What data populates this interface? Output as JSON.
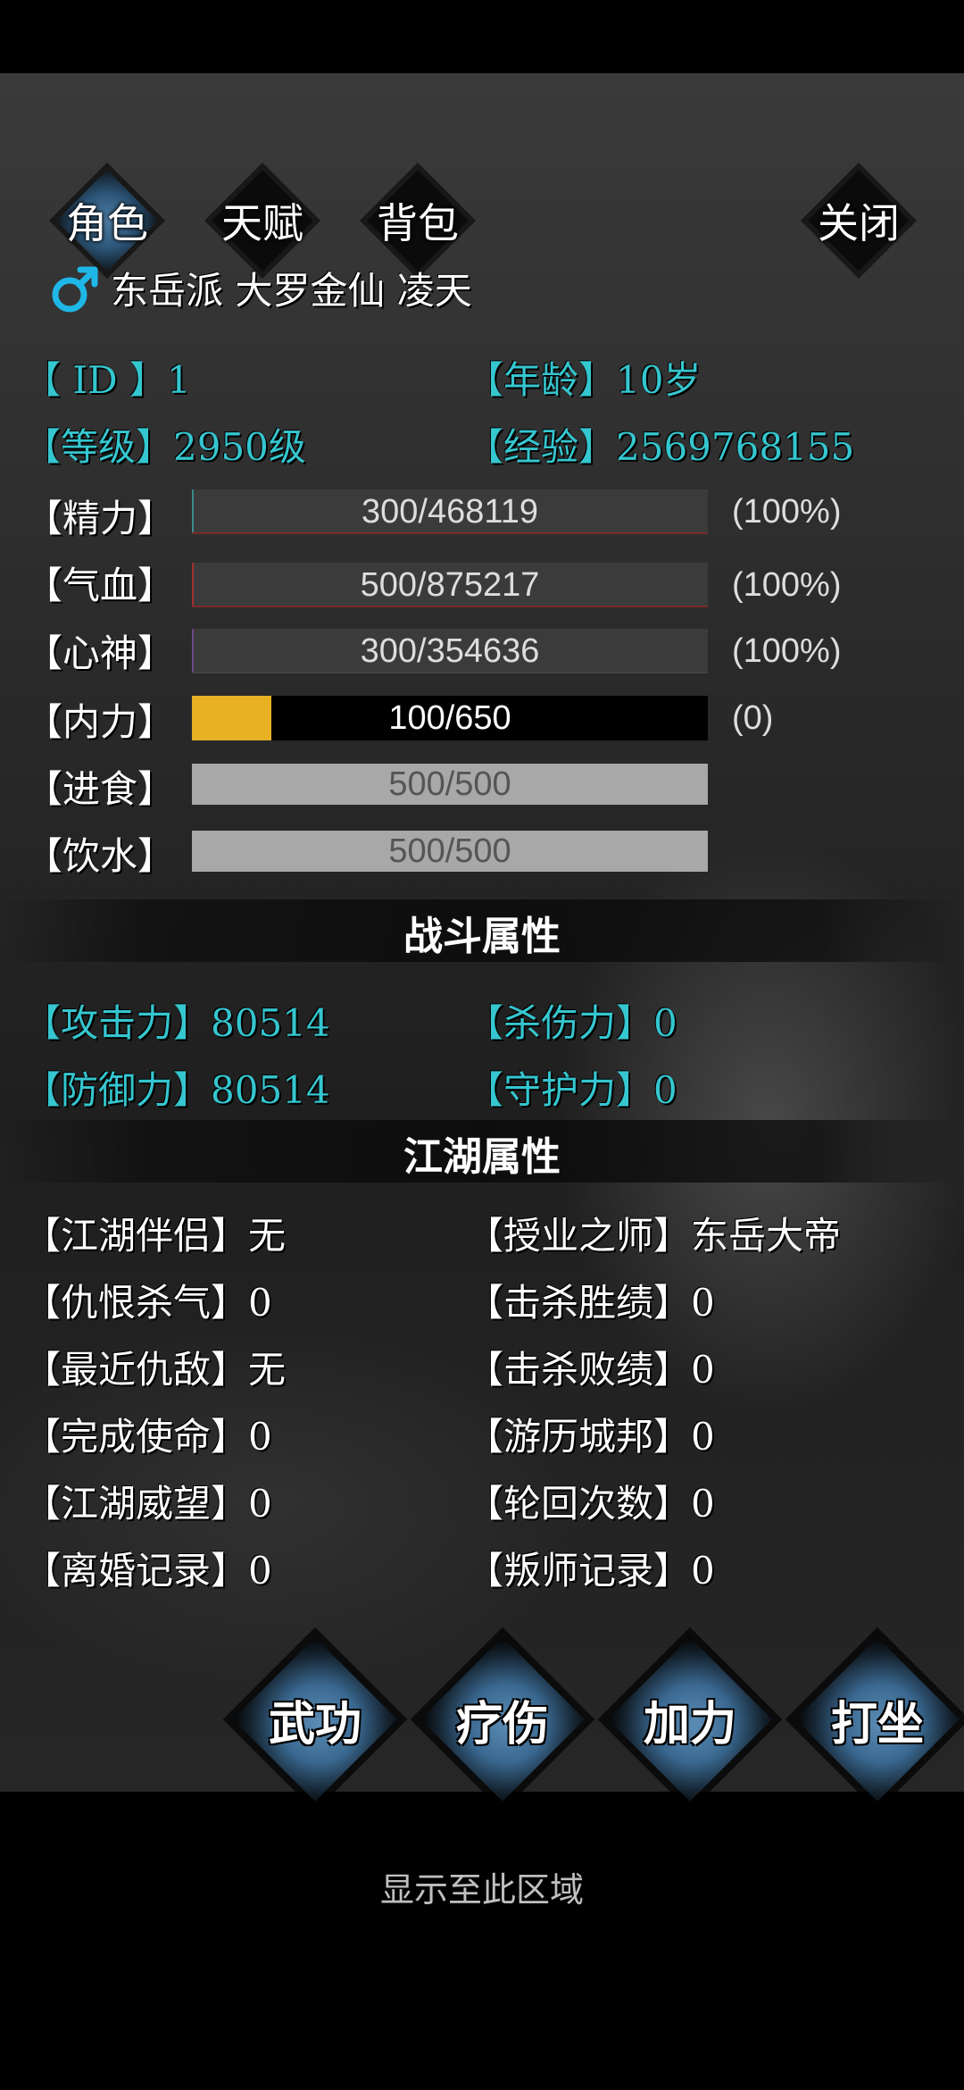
{
  "tabs": [
    {
      "label": "角色",
      "active": true
    },
    {
      "label": "天赋",
      "active": false
    },
    {
      "label": "背包",
      "active": false
    }
  ],
  "close_label": "关闭",
  "profile": {
    "gender_icon": "male-icon",
    "title_line": "东岳派 大罗金仙 凌天"
  },
  "info": {
    "id_label": "【 ID 】",
    "id_value": "1",
    "age_label": "【年龄】",
    "age_value": "10岁",
    "level_label": "【等级】",
    "level_value": "2950级",
    "exp_label": "【经验】",
    "exp_value": "2569768155"
  },
  "bars": [
    {
      "label": "【精力】",
      "text": "300/468119",
      "pct": "(100%)",
      "fill": 0.0,
      "fill_color": "#3a8a8a",
      "bg": "#3b3b3b",
      "border": "#7a2a2a"
    },
    {
      "label": "【气血】",
      "text": "500/875217",
      "pct": "(100%)",
      "fill": 0.0,
      "fill_color": "#a03030",
      "bg": "#3b3b3b",
      "border": "#7a2a2a"
    },
    {
      "label": "【心神】",
      "text": "300/354636",
      "pct": "(100%)",
      "fill": 0.0,
      "fill_color": "#6a4a8a",
      "bg": "#3b3b3b",
      "border": "#444"
    },
    {
      "label": "【内力】",
      "text": "100/650",
      "pct": "(0)",
      "fill": 0.154,
      "fill_color": "#e8b023",
      "bg": "#000000",
      "border": "#000"
    },
    {
      "label": "【进食】",
      "text": "500/500",
      "pct": "",
      "fill": 1.0,
      "fill_color": "#a8a8a8",
      "bg": "#a8a8a8",
      "border": "#a8a8a8"
    },
    {
      "label": "【饮水】",
      "text": "500/500",
      "pct": "",
      "fill": 1.0,
      "fill_color": "#a8a8a8",
      "bg": "#a8a8a8",
      "border": "#a8a8a8"
    }
  ],
  "combat": {
    "title": "战斗属性",
    "attack_label": "【攻击力】",
    "attack_value": "80514",
    "kill_label": "【杀伤力】",
    "kill_value": "0",
    "defense_label": "【防御力】",
    "defense_value": "80514",
    "guard_label": "【守护力】",
    "guard_value": "0"
  },
  "jianghu": {
    "title": "江湖属性",
    "left": [
      {
        "label": "【江湖伴侣】",
        "value": "无"
      },
      {
        "label": "【仇恨杀气】",
        "value": "0"
      },
      {
        "label": "【最近仇敌】",
        "value": "无"
      },
      {
        "label": "【完成使命】",
        "value": "0"
      },
      {
        "label": "【江湖威望】",
        "value": "0"
      },
      {
        "label": "【离婚记录】",
        "value": "0"
      }
    ],
    "right": [
      {
        "label": "【授业之师】",
        "value": "东岳大帝"
      },
      {
        "label": "【击杀胜绩】",
        "value": "0"
      },
      {
        "label": "【击杀败绩】",
        "value": "0"
      },
      {
        "label": "【游历城邦】",
        "value": "0"
      },
      {
        "label": "【轮回次数】",
        "value": "0"
      },
      {
        "label": "【叛师记录】",
        "value": "0"
      }
    ]
  },
  "actions": [
    {
      "label": "武功"
    },
    {
      "label": "疗伤"
    },
    {
      "label": "加力"
    },
    {
      "label": "打坐"
    }
  ],
  "footer": "显示至此区域",
  "colors": {
    "accent_cyan": "#35c6cf",
    "gender": "#1fb7e8",
    "inner_power": "#e8b023"
  }
}
